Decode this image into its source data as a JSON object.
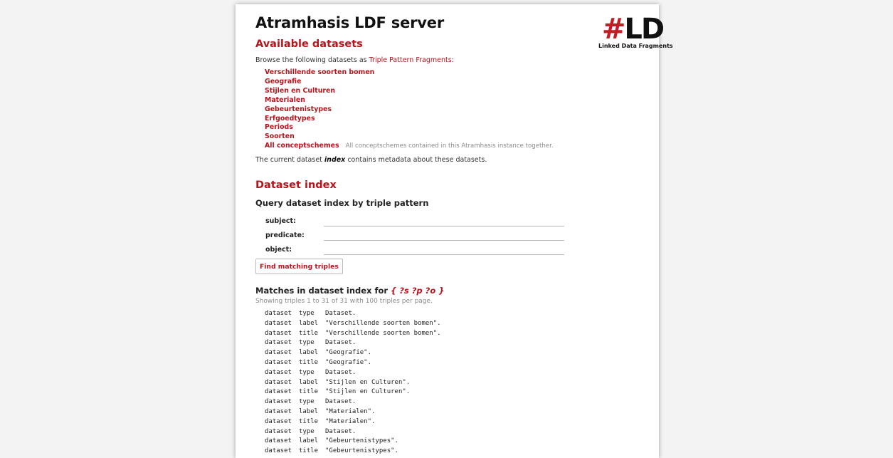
{
  "header": {
    "title": "Atramhasis LDF server",
    "logo_hash": "#",
    "logo_ld": "LD",
    "logo_tagline": "Linked Data Fragments"
  },
  "available": {
    "heading": "Available datasets",
    "intro_prefix": "Browse the following datasets as ",
    "intro_link": "Triple Pattern Fragments",
    "intro_suffix": ":",
    "datasets": [
      {
        "name": "Verschillende soorten bomen",
        "desc": ""
      },
      {
        "name": "Geografie",
        "desc": ""
      },
      {
        "name": "Stijlen en Culturen",
        "desc": ""
      },
      {
        "name": "Materialen",
        "desc": ""
      },
      {
        "name": "Gebeurtenistypes",
        "desc": ""
      },
      {
        "name": "Erfgoedtypes",
        "desc": ""
      },
      {
        "name": "Periods",
        "desc": ""
      },
      {
        "name": "Soorten",
        "desc": ""
      },
      {
        "name": "All conceptschemes",
        "desc": "All conceptschemes contained in this Atramhasis instance together."
      }
    ],
    "current_prefix": "The current dataset ",
    "current_name": "index",
    "current_suffix": " contains metadata about these datasets."
  },
  "index": {
    "heading": "Dataset index",
    "query_title": "Query dataset index by triple pattern",
    "fields": {
      "subject_label": "subject:",
      "subject_value": "",
      "predicate_label": "predicate:",
      "predicate_value": "",
      "object_label": "object:",
      "object_value": ""
    },
    "find_button": "Find matching triples",
    "matches_prefix": "Matches in dataset index for ",
    "matches_pattern": "{ ?s ?p ?o }",
    "showing": "Showing triples 1 to 31 of 31 with 100 triples per page.",
    "triples": [
      {
        "s": "dataset",
        "p": "type",
        "o": "Dataset."
      },
      {
        "s": "dataset",
        "p": "label",
        "o": "\"Verschillende soorten bomen\"."
      },
      {
        "s": "dataset",
        "p": "title",
        "o": "\"Verschillende soorten bomen\"."
      },
      {
        "s": "dataset",
        "p": "type",
        "o": "Dataset."
      },
      {
        "s": "dataset",
        "p": "label",
        "o": "\"Geografie\"."
      },
      {
        "s": "dataset",
        "p": "title",
        "o": "\"Geografie\"."
      },
      {
        "s": "dataset",
        "p": "type",
        "o": "Dataset."
      },
      {
        "s": "dataset",
        "p": "label",
        "o": "\"Stijlen en Culturen\"."
      },
      {
        "s": "dataset",
        "p": "title",
        "o": "\"Stijlen en Culturen\"."
      },
      {
        "s": "dataset",
        "p": "type",
        "o": "Dataset."
      },
      {
        "s": "dataset",
        "p": "label",
        "o": "\"Materialen\"."
      },
      {
        "s": "dataset",
        "p": "title",
        "o": "\"Materialen\"."
      },
      {
        "s": "dataset",
        "p": "type",
        "o": "Dataset."
      },
      {
        "s": "dataset",
        "p": "label",
        "o": "\"Gebeurtenistypes\"."
      },
      {
        "s": "dataset",
        "p": "title",
        "o": "\"Gebeurtenistypes\"."
      }
    ]
  },
  "colors": {
    "accent": "#b8141c",
    "background": "#f3f3f3",
    "muted": "#8a8a8a"
  }
}
